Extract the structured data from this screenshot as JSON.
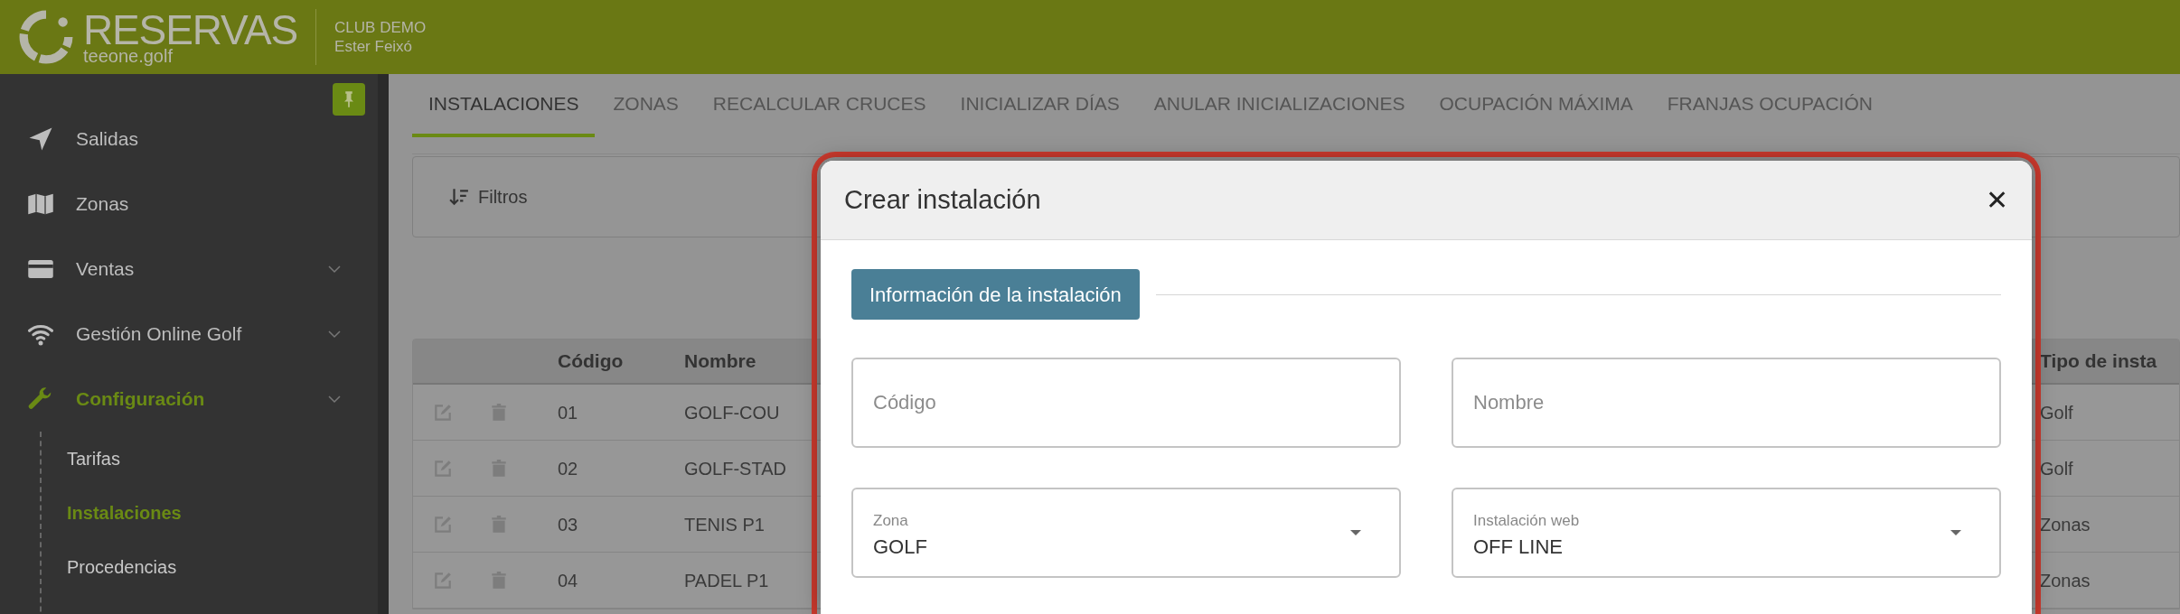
{
  "header": {
    "logo_title": "RESERVAS",
    "logo_subtitle": "teeone.golf",
    "club": "CLUB DEMO",
    "user": "Ester Feixó"
  },
  "sidebar": {
    "pinned": true,
    "items": [
      {
        "label": "Salidas",
        "has_submenu": false,
        "selected": false
      },
      {
        "label": "Zonas",
        "has_submenu": false,
        "selected": false
      },
      {
        "label": "Ventas",
        "has_submenu": true,
        "selected": false
      },
      {
        "label": "Gestión Online Golf",
        "has_submenu": true,
        "selected": false
      },
      {
        "label": "Configuración",
        "has_submenu": true,
        "selected": true,
        "children": [
          {
            "label": "Tarifas",
            "selected": false
          },
          {
            "label": "Instalaciones",
            "selected": true
          },
          {
            "label": "Procedencias",
            "selected": false
          }
        ]
      }
    ]
  },
  "tabs": [
    {
      "label": "INSTALACIONES",
      "selected": true
    },
    {
      "label": "ZONAS",
      "selected": false
    },
    {
      "label": "RECALCULAR CRUCES",
      "selected": false
    },
    {
      "label": "INICIALIZAR DÍAS",
      "selected": false
    },
    {
      "label": "ANULAR INICIALIZACIONES",
      "selected": false
    },
    {
      "label": "OCUPACIÓN MÁXIMA",
      "selected": false
    },
    {
      "label": "FRANJAS OCUPACIÓN",
      "selected": false
    }
  ],
  "filter_button": "Filtros",
  "table": {
    "columns": [
      "Código",
      "Nombre",
      "Tipo de insta"
    ],
    "rows": [
      {
        "code": "01",
        "name": "GOLF-COU",
        "type": "Golf"
      },
      {
        "code": "02",
        "name": "GOLF-STAD",
        "type": "Golf"
      },
      {
        "code": "03",
        "name": "TENIS P1",
        "type": "Zonas"
      },
      {
        "code": "04",
        "name": "PADEL P1",
        "type": "Zonas"
      }
    ]
  },
  "modal": {
    "title": "Crear instalación",
    "close": "✕",
    "section": "Información de la instalación",
    "fields": [
      {
        "kind": "text",
        "placeholder": "Código"
      },
      {
        "kind": "text",
        "placeholder": "Nombre"
      },
      {
        "kind": "select",
        "label": "Zona",
        "value": "GOLF"
      },
      {
        "kind": "select",
        "label": "Instalación web",
        "value": "OFF LINE"
      }
    ]
  }
}
